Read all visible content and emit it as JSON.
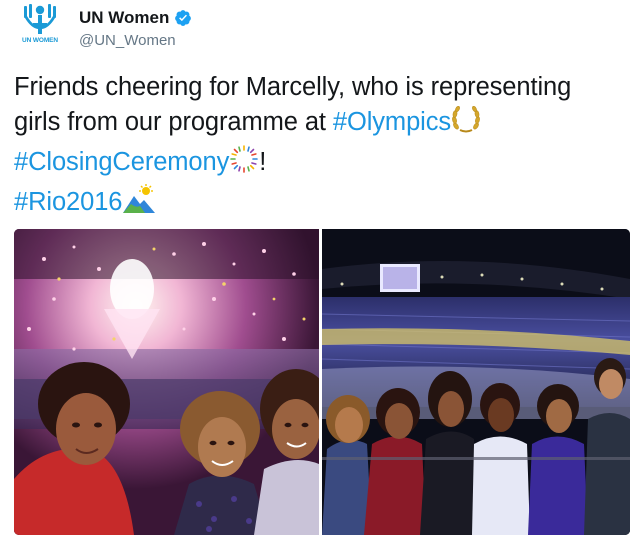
{
  "account": {
    "display_name": "UN Women",
    "handle": "@UN_Women",
    "avatar_caption": "UN WOMEN",
    "verified": true
  },
  "tweet": {
    "text_before": "Friends cheering for Marcelly, who is representing girls from our programme at ",
    "hashtag_1": "#Olympics",
    "hashtag_2": "#ClosingCeremony",
    "punctuation": "!",
    "hashtag_3": "#Rio2016"
  },
  "media": {
    "count": 2,
    "photos": [
      {
        "subject": "selfie of three friends in stadium with confetti"
      },
      {
        "subject": "group of seven friends standing in stadium stands"
      }
    ]
  },
  "colors": {
    "hashtag": "#1b95e0",
    "brand": "#1b9ad6",
    "verified": "#1da1f2",
    "text": "#14171a",
    "secondary": "#657786"
  },
  "icons": [
    "un-women-logo-icon",
    "verified-badge-icon",
    "laurel-wreath-icon",
    "fireworks-icon",
    "mountain-sun-icon"
  ]
}
